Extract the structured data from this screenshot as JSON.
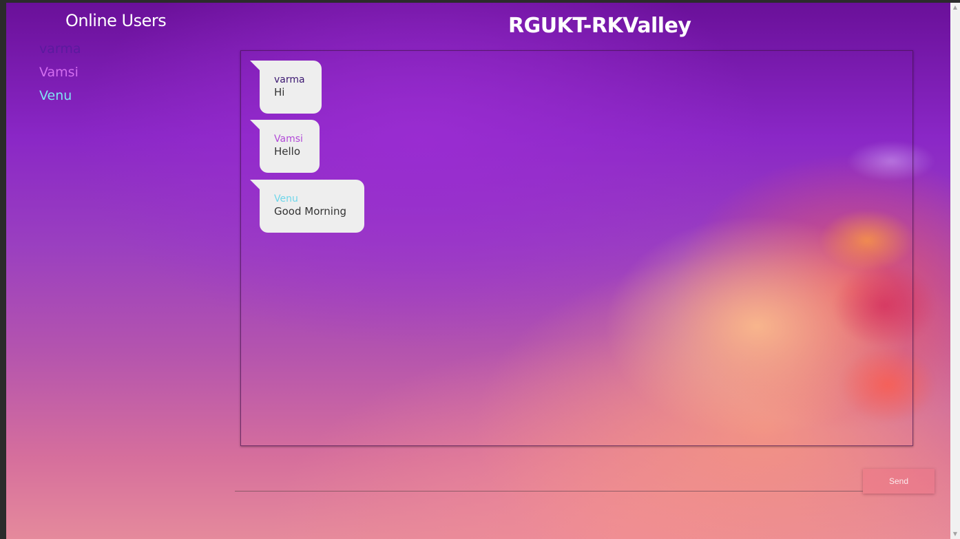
{
  "sidebar": {
    "title": "Online Users",
    "users": [
      {
        "name": "varma",
        "color": "#5b1a9e"
      },
      {
        "name": "Vamsi",
        "color": "#d36ef0"
      },
      {
        "name": "Venu",
        "color": "#7fe4f2"
      }
    ]
  },
  "header": {
    "title": "RGUKT-RKValley"
  },
  "chat": {
    "messages": [
      {
        "sender": "varma",
        "text": "Hi",
        "sender_color": "#3a1670"
      },
      {
        "sender": "Vamsi",
        "text": "Hello",
        "sender_color": "#b24ad8"
      },
      {
        "sender": "Venu",
        "text": "Good Morning",
        "sender_color": "#6fd6ea"
      }
    ]
  },
  "composer": {
    "input_value": "",
    "send_label": "Send"
  },
  "scrollbar": {
    "up_icon": "triangle-up",
    "down_icon": "triangle-down"
  }
}
